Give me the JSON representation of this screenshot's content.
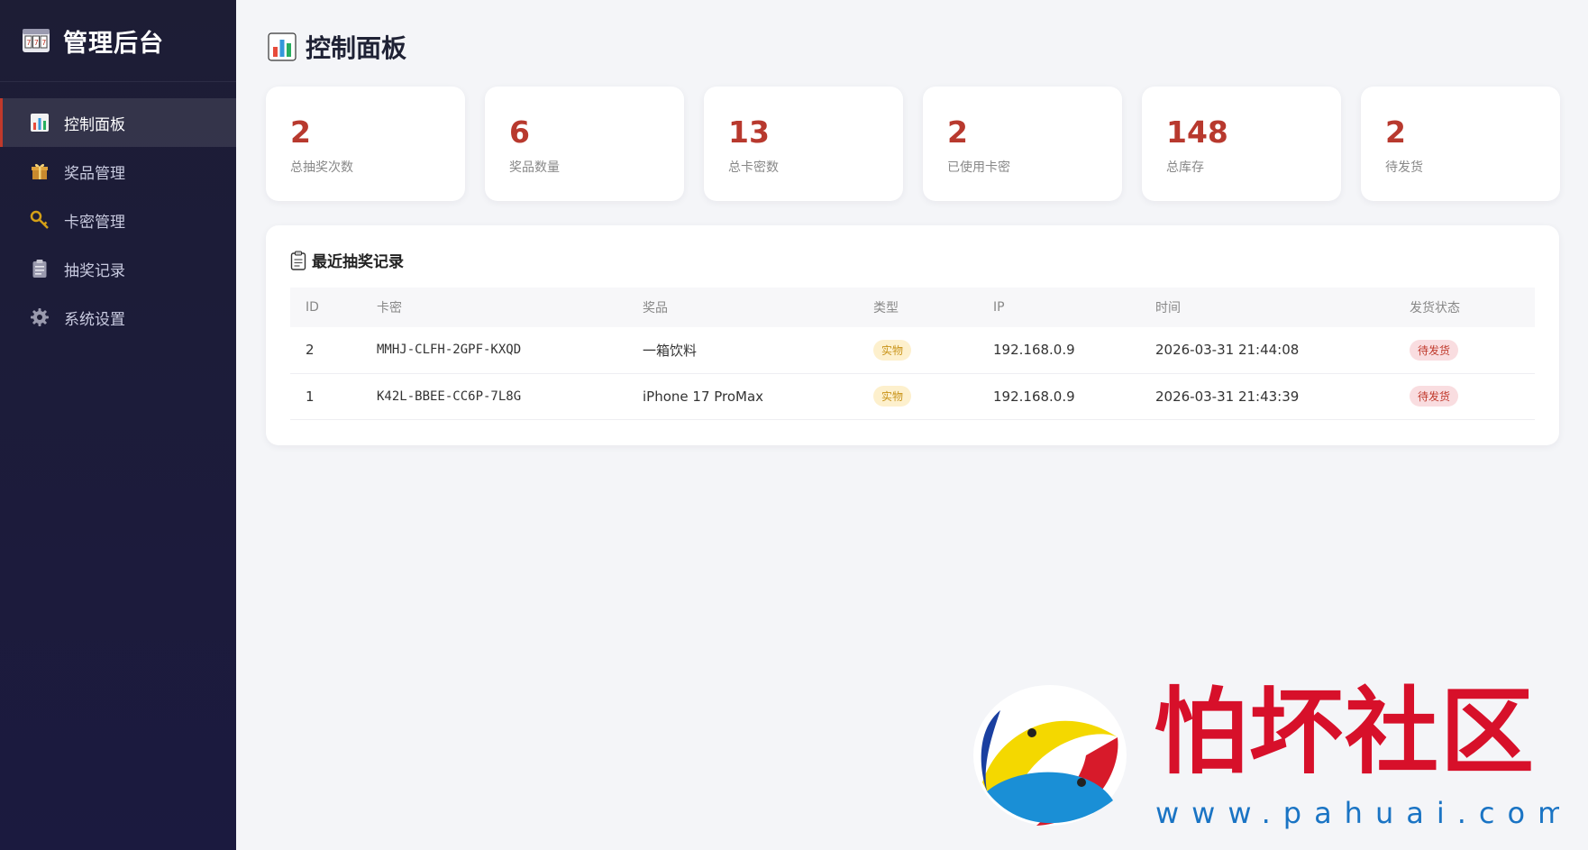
{
  "sidebar": {
    "brand": "管理后台",
    "items": [
      {
        "label": "控制面板",
        "icon": "bar-chart-icon",
        "active": true
      },
      {
        "label": "奖品管理",
        "icon": "gift-icon",
        "active": false
      },
      {
        "label": "卡密管理",
        "icon": "key-icon",
        "active": false
      },
      {
        "label": "抽奖记录",
        "icon": "clipboard-icon",
        "active": false
      },
      {
        "label": "系统设置",
        "icon": "gear-icon",
        "active": false
      }
    ]
  },
  "main": {
    "title": "控制面板",
    "stats": [
      {
        "value": "2",
        "label": "总抽奖次数"
      },
      {
        "value": "6",
        "label": "奖品数量"
      },
      {
        "value": "13",
        "label": "总卡密数"
      },
      {
        "value": "2",
        "label": "已使用卡密"
      },
      {
        "value": "148",
        "label": "总库存"
      },
      {
        "value": "2",
        "label": "待发货"
      }
    ],
    "recent": {
      "title": "最近抽奖记录",
      "columns": [
        "ID",
        "卡密",
        "奖品",
        "类型",
        "IP",
        "时间",
        "发货状态"
      ],
      "rows": [
        {
          "id": "2",
          "code": "MMHJ-CLFH-2GPF-KXQD",
          "prize": "一箱饮料",
          "type": "实物",
          "ip": "192.168.0.9",
          "time": "2026-03-31 21:44:08",
          "status": "待发货"
        },
        {
          "id": "1",
          "code": "K42L-BBEE-CC6P-7L8G",
          "prize": "iPhone 17 ProMax",
          "type": "实物",
          "ip": "192.168.0.9",
          "time": "2026-03-31 21:43:39",
          "status": "待发货"
        }
      ]
    }
  },
  "watermark": {
    "text": "怕坏社区",
    "url": "www.pahuai.com"
  },
  "colors": {
    "sidebar_bg": "#1d1d35",
    "accent": "#b8392e",
    "badge_type_bg": "#fdf0cd",
    "badge_status_bg": "#f9dde0"
  }
}
